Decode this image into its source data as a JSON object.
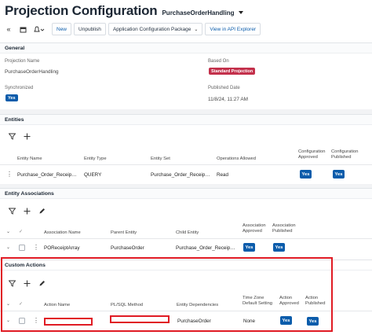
{
  "header": {
    "title": "Projection Configuration",
    "projection": "PurchaseOrderHandling"
  },
  "toolbar": {
    "icons": [
      "collapse-icon",
      "calendar-icon",
      "bell-icon"
    ],
    "new_label": "New",
    "unpublish_label": "Unpublish",
    "package_label": "Application Configuration Package",
    "api_label": "View in API Explorer"
  },
  "general": {
    "title": "General",
    "projection_name_label": "Projection Name",
    "projection_name_value": "PurchaseOrderHandling",
    "based_on_label": "Based On",
    "based_on_value": "Standard Projection",
    "synchronized_label": "Synchronized",
    "synchronized_value": "Yes",
    "published_date_label": "Published Date",
    "published_date_value": "11/8/24, 11:27 AM"
  },
  "entities": {
    "title": "Entities",
    "columns": [
      "Entity Name",
      "Entity Type",
      "Entity Set",
      "Operations Allowed",
      "Configuration Approved",
      "Configuration Published"
    ],
    "rows": [
      {
        "entity_name": "Purchase_Order_Receip…",
        "entity_type": "QUERY",
        "entity_set": "Purchase_Order_Receip…",
        "operations": "Read",
        "approved": "Yes",
        "published": "Yes"
      }
    ]
  },
  "entity_associations": {
    "title": "Entity Associations",
    "columns": [
      "Association Name",
      "Parent Entity",
      "Child Entity",
      "Association Approved",
      "Association Published"
    ],
    "rows": [
      {
        "name": "POReceiptArray",
        "parent": "PurchaseOrder",
        "child": "Purchase_Order_Receip…",
        "approved": "Yes",
        "published": "Yes"
      }
    ]
  },
  "custom_actions": {
    "title": "Custom Actions",
    "columns": [
      "Action Name",
      "PL/SQL Method",
      "Entity Dependencies",
      "Time Zone Default Setting",
      "Action Approved",
      "Action Published"
    ],
    "rows": [
      {
        "action_name": "",
        "plsql_method": "",
        "entity_dependencies": "PurchaseOrder",
        "time_zone": "None",
        "approved": "Yes",
        "published": "Yes"
      }
    ]
  },
  "colors": {
    "accent": "#0b5cab",
    "standard_badge": "#c3304b",
    "highlight": "#e01b24"
  }
}
